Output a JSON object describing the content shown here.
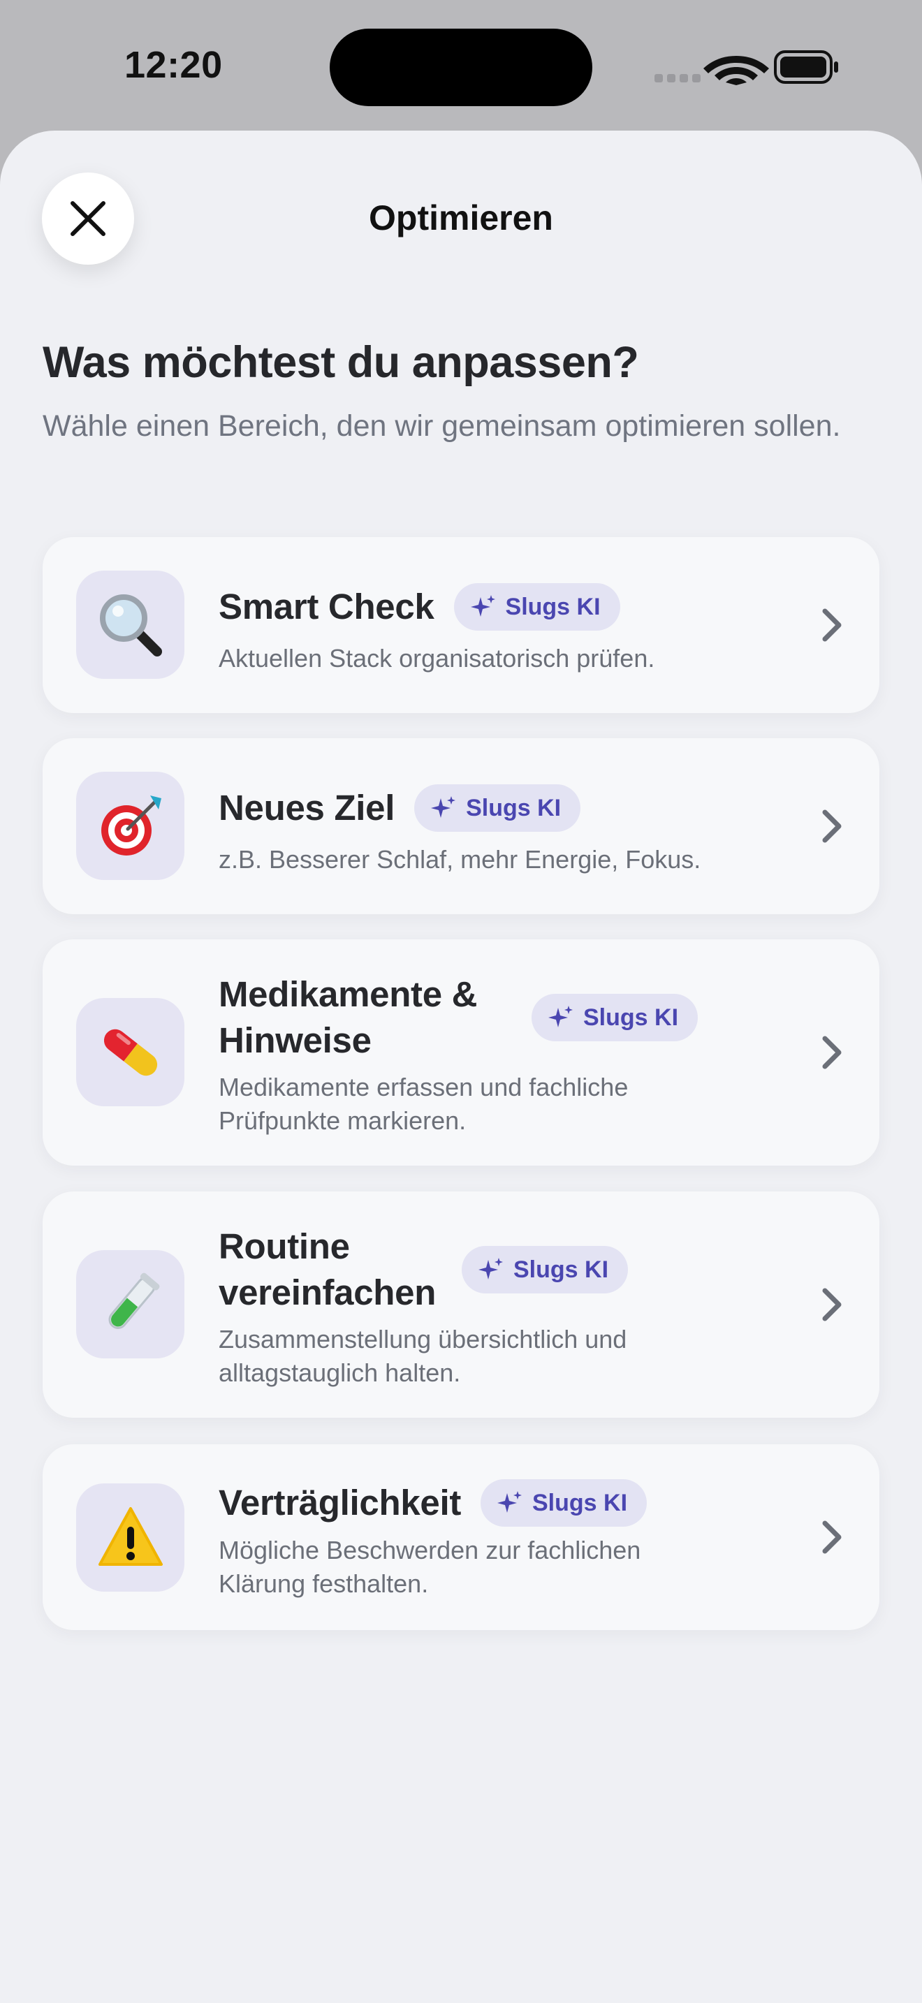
{
  "status_bar": {
    "time": "12:20",
    "icons": [
      "cellular-dots-icon",
      "wifi-icon",
      "battery-icon"
    ]
  },
  "sheet": {
    "title": "Optimieren",
    "close_icon": "close-icon"
  },
  "header": {
    "heading": "Was möchtest du anpassen?",
    "subheading": "Wähle einen Bereich, den wir gemeinsam optimieren sollen."
  },
  "colors": {
    "accent": "#4a46b0",
    "badge_bg": "#e3e3f3",
    "tile_bg": "#e5e4f3",
    "card_bg": "#f7f8fa",
    "sheet_bg": "#eff0f4"
  },
  "options": [
    {
      "icon": "magnifying-glass-icon",
      "title": "Smart Check",
      "badge": "Slugs KI",
      "description": "Aktuellen Stack organisatorisch prüfen."
    },
    {
      "icon": "target-icon",
      "title": "Neues Ziel",
      "badge": "Slugs KI",
      "description": "z.B. Besserer Schlaf, mehr Energie, Fokus."
    },
    {
      "icon": "pill-icon",
      "title": "Medikamente & Hinweise",
      "badge": "Slugs KI",
      "description": "Medikamente erfassen und fachliche Prüfpunkte markieren."
    },
    {
      "icon": "test-tube-icon",
      "title": "Routine vereinfachen",
      "badge": "Slugs KI",
      "description": "Zusammenstellung übersichtlich und alltagstauglich halten."
    },
    {
      "icon": "warning-icon",
      "title": "Verträglichkeit",
      "badge": "Slugs KI",
      "description": "Mögliche Beschwerden zur fachlichen Klärung festhalten."
    }
  ]
}
